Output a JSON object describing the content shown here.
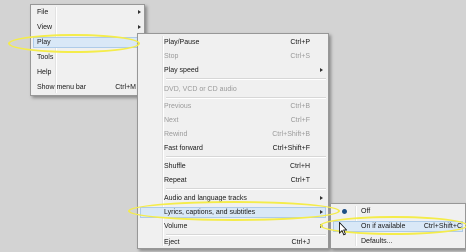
{
  "main_menu": {
    "items": [
      {
        "label": "File",
        "arrow": true
      },
      {
        "label": "View",
        "arrow": true
      },
      {
        "label": "Play",
        "arrow": true,
        "highlighted": true
      },
      {
        "label": "Tools",
        "arrow": true
      },
      {
        "label": "Help",
        "arrow": true
      },
      {
        "label": "Show menu bar",
        "shortcut": "Ctrl+M"
      }
    ]
  },
  "play_menu": {
    "items": [
      {
        "label": "Play/Pause",
        "shortcut": "Ctrl+P"
      },
      {
        "label": "Stop",
        "shortcut": "Ctrl+S",
        "disabled": true
      },
      {
        "label": "Play speed",
        "arrow": true
      },
      {
        "label": "DVD, VCD or CD audio",
        "disabled": true
      },
      {
        "label": "Previous",
        "shortcut": "Ctrl+B",
        "disabled": true
      },
      {
        "label": "Next",
        "shortcut": "Ctrl+F",
        "disabled": true
      },
      {
        "label": "Rewind",
        "shortcut": "Ctrl+Shift+B",
        "disabled": true
      },
      {
        "label": "Fast forward",
        "shortcut": "Ctrl+Shift+F"
      },
      {
        "label": "Shuffle",
        "shortcut": "Ctrl+H"
      },
      {
        "label": "Repeat",
        "shortcut": "Ctrl+T"
      },
      {
        "label": "Audio and language tracks",
        "arrow": true
      },
      {
        "label": "Lyrics, captions, and subtitles",
        "arrow": true,
        "highlighted": true
      },
      {
        "label": "Volume",
        "arrow": true
      },
      {
        "label": "Eject",
        "shortcut": "Ctrl+J"
      }
    ]
  },
  "captions_menu": {
    "items": [
      {
        "label": "Off",
        "selected": true
      },
      {
        "label": "On if available",
        "shortcut": "Ctrl+Shift+C",
        "highlighted": true
      },
      {
        "label": "Defaults..."
      }
    ]
  },
  "colors": {
    "annotation": "#f4ec4a",
    "highlight": "#d9e8f7",
    "radio_dot": "#1d4f86"
  }
}
